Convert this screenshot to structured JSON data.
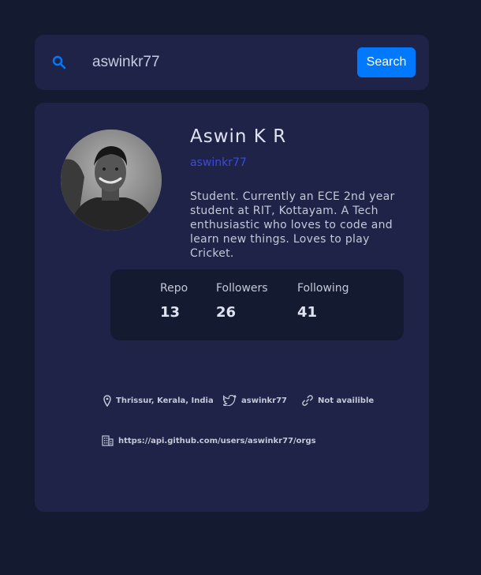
{
  "search": {
    "value": "aswinkr77",
    "button_label": "Search"
  },
  "profile": {
    "name": "Aswin K R",
    "username": "aswinkr77",
    "bio": "Student. Currently an ECE 2nd year student at RIT, Kottayam. A Tech enthusiastic who loves to code and learn new things. Loves to play Cricket."
  },
  "stats": {
    "repo_label": "Repo",
    "repo_value": "13",
    "followers_label": "Followers",
    "followers_value": "26",
    "following_label": "Following",
    "following_value": "41"
  },
  "links": {
    "location": "Thrissur, Kerala, India",
    "twitter": "aswinkr77",
    "website": "Not availible",
    "company": "https://api.github.com/users/aswinkr77/orgs"
  },
  "colors": {
    "background": "#141a30",
    "card": "#1f2347",
    "accent": "#0079ff",
    "username": "#3b4bdc"
  }
}
